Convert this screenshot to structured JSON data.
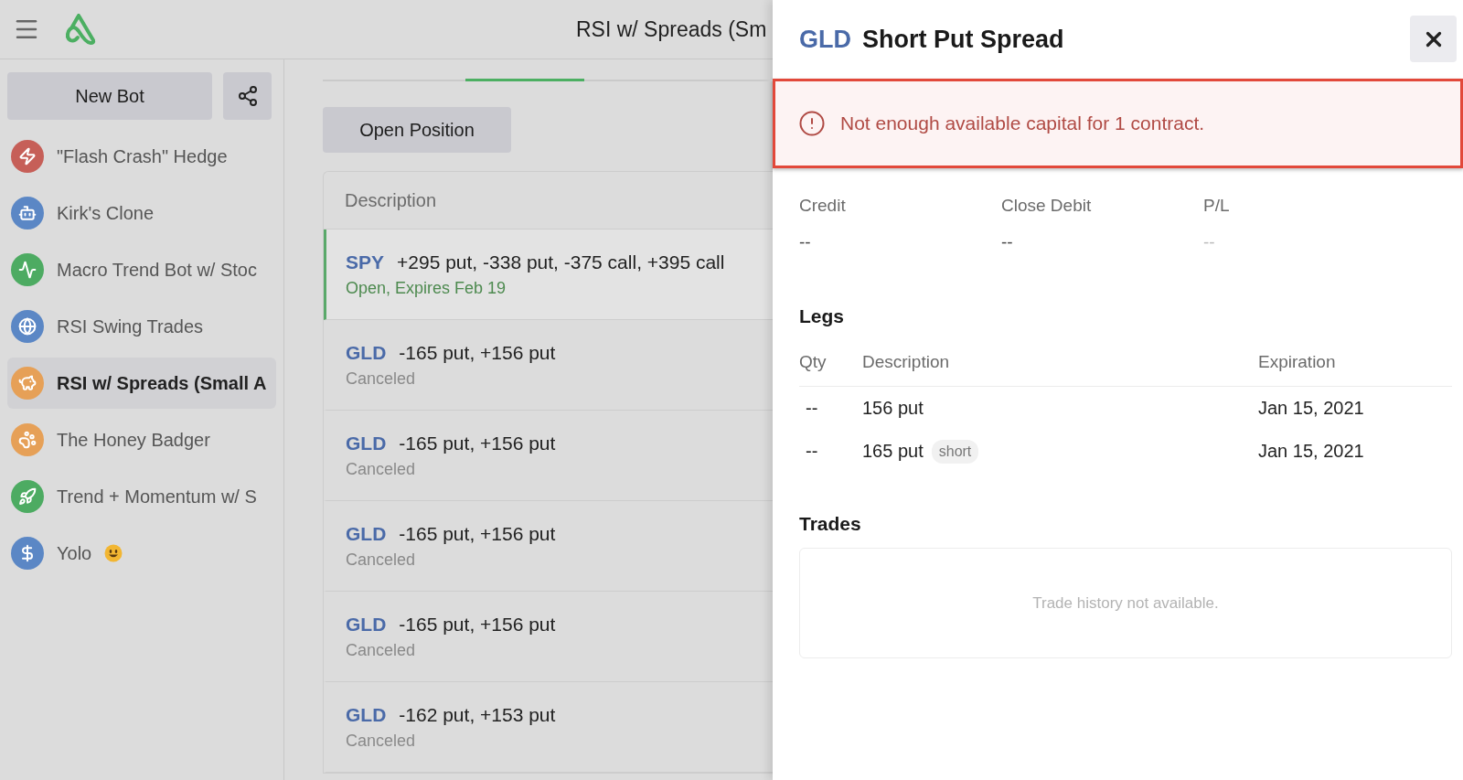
{
  "app": {
    "title": "RSI w/ Spreads (Sm"
  },
  "sidebar": {
    "new_bot": "New Bot",
    "items": [
      {
        "label": "\"Flash Crash\" Hedge",
        "color": "#c65f58",
        "selected": false
      },
      {
        "label": "Kirk's Clone",
        "color": "#5b87c5",
        "selected": false
      },
      {
        "label": "Macro Trend Bot w/ Stoc",
        "color": "#4dab62",
        "selected": false
      },
      {
        "label": "RSI Swing Trades",
        "color": "#5b87c5",
        "selected": false
      },
      {
        "label": "RSI w/ Spreads (Small A",
        "color": "#e6a057",
        "selected": true
      },
      {
        "label": "The Honey Badger",
        "color": "#e6a057",
        "selected": false
      },
      {
        "label": "Trend + Momentum w/ S",
        "color": "#4dab62",
        "selected": false
      },
      {
        "label": "Yolo",
        "color": "#5b87c5",
        "selected": false
      }
    ]
  },
  "main": {
    "open_position": "Open Position",
    "column": "Description",
    "rows": [
      {
        "symbol": "SPY",
        "legs": "+295 put, -338 put, -375 call, +395 call",
        "status": "Open, Expires Feb 19",
        "kind": "open",
        "selected": true
      },
      {
        "symbol": "GLD",
        "legs": "-165 put, +156 put",
        "status": "Canceled",
        "kind": "canceled",
        "selected": false
      },
      {
        "symbol": "GLD",
        "legs": "-165 put, +156 put",
        "status": "Canceled",
        "kind": "canceled",
        "selected": false
      },
      {
        "symbol": "GLD",
        "legs": "-165 put, +156 put",
        "status": "Canceled",
        "kind": "canceled",
        "selected": false
      },
      {
        "symbol": "GLD",
        "legs": "-165 put, +156 put",
        "status": "Canceled",
        "kind": "canceled",
        "selected": false
      },
      {
        "symbol": "GLD",
        "legs": "-162 put, +153 put",
        "status": "Canceled",
        "kind": "canceled",
        "selected": false
      }
    ]
  },
  "drawer": {
    "symbol": "GLD",
    "title": "Short Put Spread",
    "alert": "Not enough available capital for 1 contract.",
    "stats": [
      {
        "label": "Credit",
        "value": "--",
        "muted": false
      },
      {
        "label": "Close Debit",
        "value": "--",
        "muted": false
      },
      {
        "label": "P/L",
        "value": "--",
        "muted": true
      }
    ],
    "legs": {
      "heading": "Legs",
      "columns": [
        "Qty",
        "Description",
        "Expiration"
      ],
      "rows": [
        {
          "qty": "--",
          "description": "156 put",
          "expiration": "Jan 15, 2021"
        },
        {
          "qty": "--",
          "description": "165 put",
          "tag": "short",
          "expiration": "Jan 15, 2021"
        }
      ]
    },
    "trades": {
      "heading": "Trades",
      "empty": "Trade history not available."
    }
  }
}
